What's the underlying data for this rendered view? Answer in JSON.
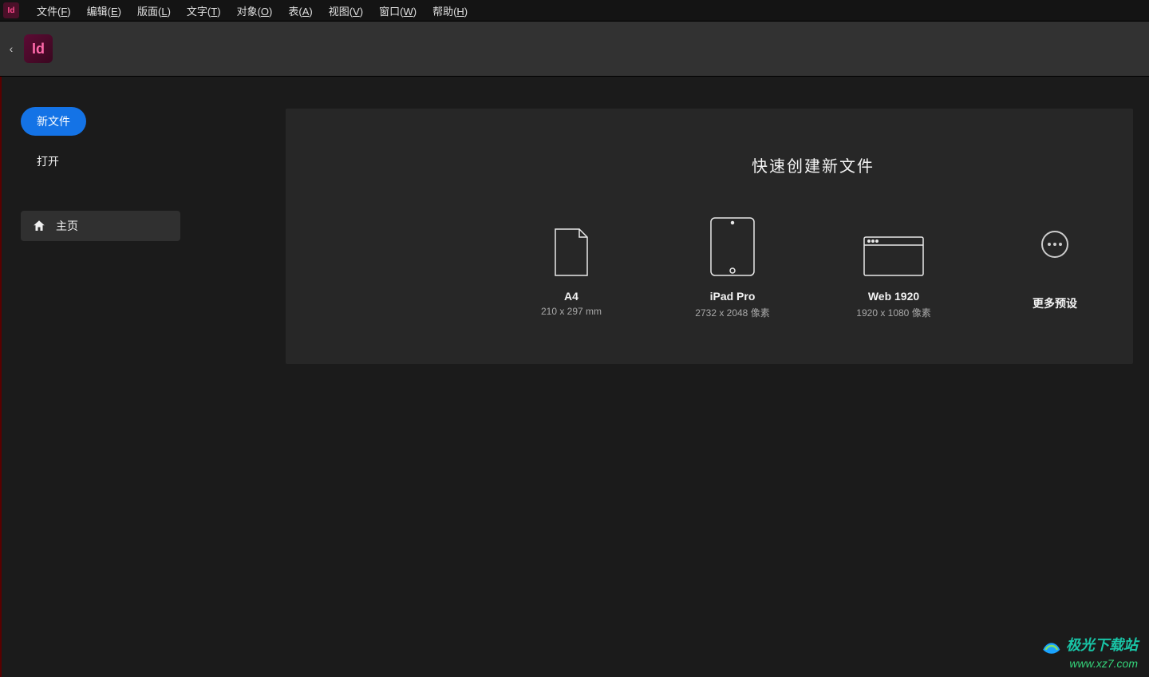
{
  "menubar": {
    "items": [
      {
        "pre": "文件(",
        "u": "F",
        "post": ")"
      },
      {
        "pre": "编辑(",
        "u": "E",
        "post": ")"
      },
      {
        "pre": "版面(",
        "u": "L",
        "post": ")"
      },
      {
        "pre": "文字(",
        "u": "T",
        "post": ")"
      },
      {
        "pre": "对象(",
        "u": "O",
        "post": ")"
      },
      {
        "pre": "表(",
        "u": "A",
        "post": ")"
      },
      {
        "pre": "视图(",
        "u": "V",
        "post": ")"
      },
      {
        "pre": "窗口(",
        "u": "W",
        "post": ")"
      },
      {
        "pre": "帮助(",
        "u": "H",
        "post": ")"
      }
    ],
    "app_badge": "Id"
  },
  "toolbar": {
    "logo_text": "Id",
    "collapse_glyph": "‹"
  },
  "sidebar": {
    "new_file_label": "新文件",
    "open_label": "打开",
    "home_label": "主页"
  },
  "panel": {
    "title": "快速创建新文件",
    "presets": [
      {
        "name": "A4",
        "sub": "210 x 297 mm",
        "icon": "page"
      },
      {
        "name": "iPad Pro",
        "sub": "2732 x 2048 像素",
        "icon": "tablet"
      },
      {
        "name": "Web 1920",
        "sub": "1920 x 1080 像素",
        "icon": "browser"
      }
    ],
    "more_label": "更多预设"
  },
  "watermark": {
    "brand": "极光下载站",
    "url": "www.xz7.com"
  }
}
